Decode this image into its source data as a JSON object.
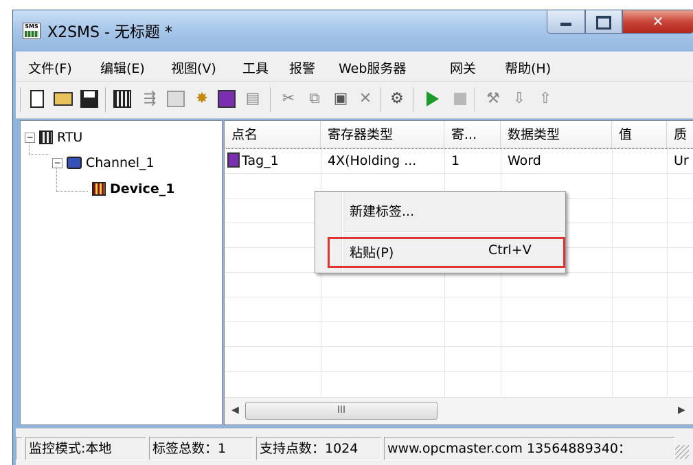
{
  "window": {
    "title": "X2SMS - 无标题 *",
    "app_icon_text": "SMS"
  },
  "menu": [
    "文件(F)",
    "编辑(E)",
    "视图(V)",
    "工具",
    "报警",
    "Web服务器",
    "网关",
    "帮助(H)"
  ],
  "toolbar_icons": [
    "new-icon",
    "open-icon",
    "save-icon",
    "rtu-icon",
    "channel-icon",
    "device-icon",
    "new-device-icon",
    "new-tag-icon",
    "properties-icon",
    "cut-icon",
    "copy-icon",
    "paste-icon",
    "delete-icon",
    "monitor-icon",
    "run-icon",
    "stop-icon",
    "tools-icon",
    "load-icon",
    "upload-icon"
  ],
  "tree": {
    "root": "RTU",
    "channel": "Channel_1",
    "device": "Device_1"
  },
  "list": {
    "columns": [
      "点名",
      "寄存器类型",
      "寄...",
      "数据类型",
      "值",
      "质"
    ],
    "rows": [
      {
        "name": "Tag_1",
        "register_type": "4X(Holding ...",
        "address": "1",
        "data_type": "Word",
        "value": "",
        "quality": "Ur"
      }
    ],
    "hscroll_thumb_glyph": "III"
  },
  "context_menu": {
    "new_tag": "新建标签...",
    "paste": "粘贴(P)",
    "paste_shortcut": "Ctrl+V"
  },
  "status": {
    "mode": "监控模式:本地",
    "tag_count": "标签总数：1",
    "supported_points": "支持点数：1024",
    "contact": "www.opcmaster.com 13564889340："
  },
  "colors": {
    "highlight_border": "#e03434",
    "close_button": "#c9463a",
    "title_gradient": "#a9c8ea"
  }
}
